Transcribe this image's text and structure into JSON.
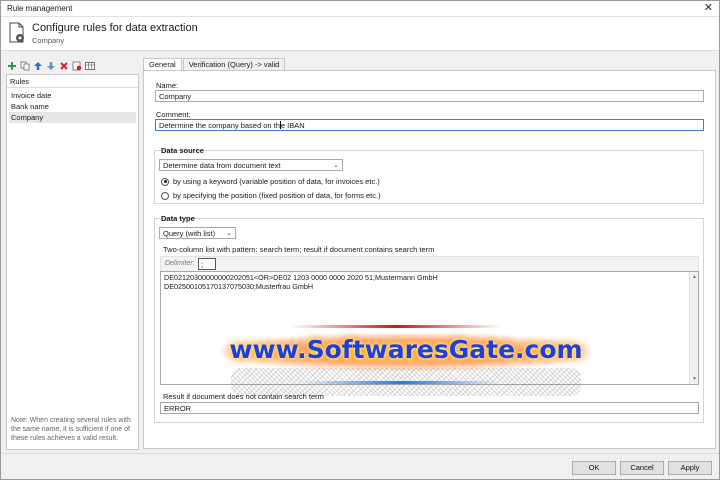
{
  "window": {
    "title": "Rule management",
    "close_glyph": "✕"
  },
  "header": {
    "title": "Configure rules for data extraction",
    "subtitle": "Company",
    "icon": "document-gear-icon"
  },
  "toolbar": {
    "icons": [
      "add-icon",
      "copy-icon",
      "move-up-icon",
      "move-down-icon",
      "delete-icon",
      "import-icon",
      "table-icon"
    ]
  },
  "rules_panel": {
    "header": "Rules",
    "items": [
      {
        "label": "Invoice date",
        "selected": false
      },
      {
        "label": "Bank name",
        "selected": false
      },
      {
        "label": "Company",
        "selected": true
      }
    ],
    "note": "Note: When creating several rules with the same name, it is sufficient if one of these rules achieves a valid result."
  },
  "tabs": [
    {
      "label": "General",
      "active": true
    },
    {
      "label": "Verification (Query) -> valid",
      "active": false
    }
  ],
  "general": {
    "name_label": "Name:",
    "name_value": "Company",
    "comment_label": "Comment:",
    "comment_before_caret": "Determine the company based on th",
    "comment_after_caret": "e IBAN"
  },
  "data_source": {
    "title": "Data source",
    "selected": "Determine data from document text",
    "options": [
      {
        "label": "by using a keyword (variable position of data, for invoices etc.)",
        "checked": true
      },
      {
        "label": "by specifying the position (fixed position of data, for forms etc.)",
        "checked": false
      }
    ]
  },
  "data_type": {
    "title": "Data type",
    "selected": "Query (with list)",
    "description": "Two-column list with pattern: search term; result if document contains search term",
    "delimiter_label": "Delimiter:",
    "delimiter_value": ";",
    "list_lines": [
      "DE02120300000000202051<OR>DE02 1203 0000 0000 2020 51;Mustermann GmbH",
      "DE02500105170137075030;Musterfrau GmbH"
    ],
    "no_match_label": "Result if document does not contain search term",
    "no_match_value": "ERROR"
  },
  "watermark": {
    "text": "www.SoftwaresGate.com"
  },
  "footer": {
    "ok": "OK",
    "cancel": "Cancel",
    "apply": "Apply"
  },
  "colors": {
    "focus_border": "#3d7cc9",
    "add_green": "#2e9e3a",
    "arrow_blue": "#2f6fc4",
    "delete_red": "#d22020"
  }
}
